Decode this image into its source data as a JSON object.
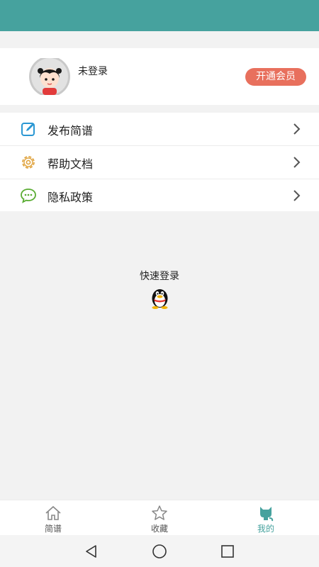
{
  "profile": {
    "user_name": "未登录",
    "vip_button_label": "开通会员"
  },
  "menu": {
    "items": [
      {
        "label": "发布简谱",
        "icon": "edit-icon"
      },
      {
        "label": "帮助文档",
        "icon": "gear-icon"
      },
      {
        "label": "隐私政策",
        "icon": "chat-bubble-icon"
      }
    ]
  },
  "quick_login": {
    "title": "快速登录",
    "icon": "qq-penguin-icon"
  },
  "tabbar": {
    "tabs": [
      {
        "label": "简谱",
        "icon": "home-icon",
        "active": false
      },
      {
        "label": "收藏",
        "icon": "star-icon",
        "active": false
      },
      {
        "label": "我的",
        "icon": "cat-icon",
        "active": true
      }
    ]
  },
  "system_nav": {
    "icons": [
      "back-triangle-icon",
      "home-circle-icon",
      "recents-square-icon"
    ]
  },
  "colors": {
    "header": "#46a29e",
    "accent": "#46a29e",
    "vip_button": "#e8705d",
    "edit_icon": "#2a97d3",
    "gear_icon": "#e0a440",
    "chat_icon": "#5aac33"
  }
}
